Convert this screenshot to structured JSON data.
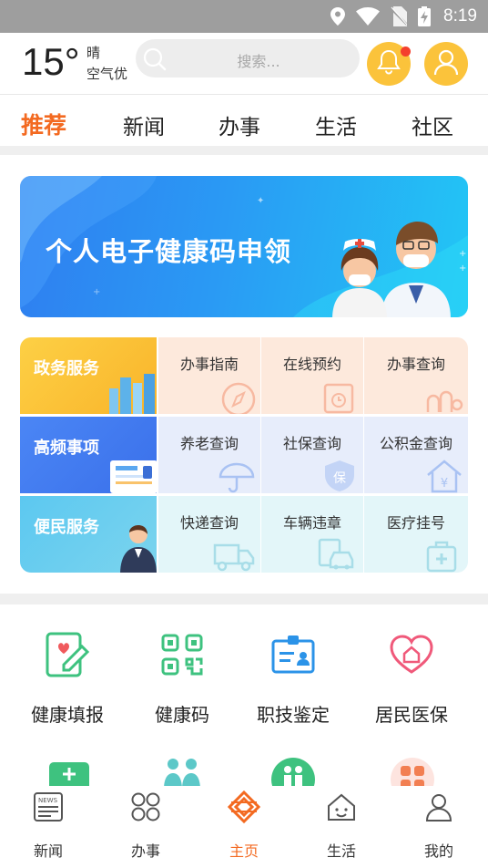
{
  "status_bar": {
    "time": "8:19"
  },
  "header": {
    "temperature": "15°",
    "weather": "晴",
    "air_quality": "空气优",
    "search_placeholder": "搜索..."
  },
  "tabs": [
    {
      "label": "推荐",
      "active": true
    },
    {
      "label": "新闻"
    },
    {
      "label": "办事"
    },
    {
      "label": "生活"
    },
    {
      "label": "社区"
    }
  ],
  "banner": {
    "title": "个人电子健康码申领"
  },
  "services": [
    {
      "category": "政务服务",
      "items": [
        "办事指南",
        "在线预约",
        "办事查询"
      ]
    },
    {
      "category": "高频事项",
      "items": [
        "养老查询",
        "社保查询",
        "公积金查询"
      ]
    },
    {
      "category": "便民服务",
      "items": [
        "快递查询",
        "车辆违章",
        "医疗挂号"
      ]
    }
  ],
  "quick_items": [
    {
      "label": "健康填报",
      "icon": "health-report-icon"
    },
    {
      "label": "健康码",
      "icon": "qr-code-icon"
    },
    {
      "label": "职技鉴定",
      "icon": "id-card-icon"
    },
    {
      "label": "居民医保",
      "icon": "heart-home-icon"
    }
  ],
  "bottom_nav": [
    {
      "label": "新闻",
      "icon": "newspaper-icon"
    },
    {
      "label": "办事",
      "icon": "grid-icon"
    },
    {
      "label": "主页",
      "icon": "home-logo-icon",
      "active": true
    },
    {
      "label": "生活",
      "icon": "house-icon"
    },
    {
      "label": "我的",
      "icon": "person-icon"
    }
  ],
  "colors": {
    "accent": "#f36a21",
    "yellow": "#fbc33b",
    "blue": "#2f7ef0"
  }
}
